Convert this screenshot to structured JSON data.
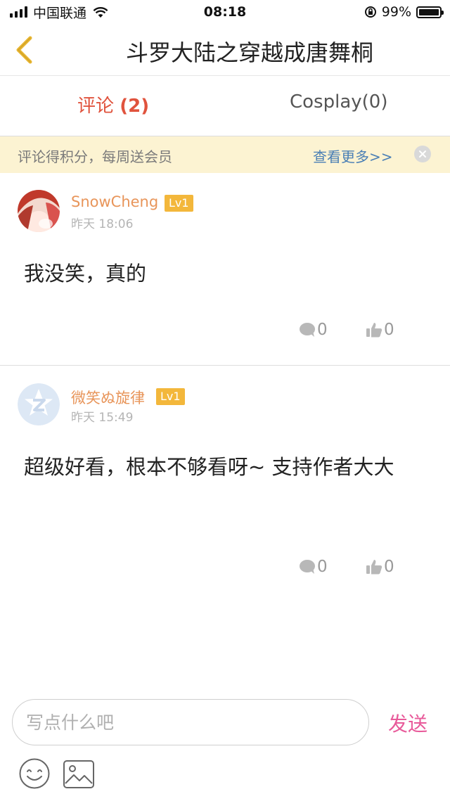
{
  "status_bar": {
    "carrier": "中国联通",
    "time": "08:18",
    "battery_percent": "99%",
    "battery_level": 0.99,
    "icons": [
      "signal-icon",
      "wifi-icon",
      "orientation-lock-icon",
      "battery-icon"
    ]
  },
  "nav": {
    "back_icon": "chevron-left-icon",
    "title": "斗罗大陆之穿越成唐舞桐"
  },
  "tabs": [
    {
      "label": "评论",
      "count": "(2)",
      "active": true
    },
    {
      "label": "Cosplay(0)",
      "active": false
    }
  ],
  "notice": {
    "text": "评论得积分，每周送会员",
    "more": "查看更多>>",
    "close_icon": "close-icon"
  },
  "comments": [
    {
      "username": "SnowCheng",
      "level": "Lv1",
      "time": "昨天 18:06",
      "text": "我没笑，真的",
      "reply_count": "0",
      "like_count": "0"
    },
    {
      "username": "微笑ぬ旋律",
      "level": "Lv1",
      "time": "昨天 15:49",
      "text": "超级好看，根本不够看呀~ 支持作者大大",
      "reply_count": "0",
      "like_count": "0"
    }
  ],
  "composer": {
    "placeholder": "写点什么吧",
    "send_label": "发送",
    "emoji_icon": "emoji-icon",
    "image_icon": "image-icon"
  },
  "colors": {
    "accent_red": "#e0533d",
    "username_orange": "#e8955a",
    "level_badge": "#f3b73b",
    "link_blue": "#4a7fb5",
    "send_pink": "#e85a9a",
    "notice_bg": "#fcf3d2",
    "back_icon": "#e8b631"
  }
}
